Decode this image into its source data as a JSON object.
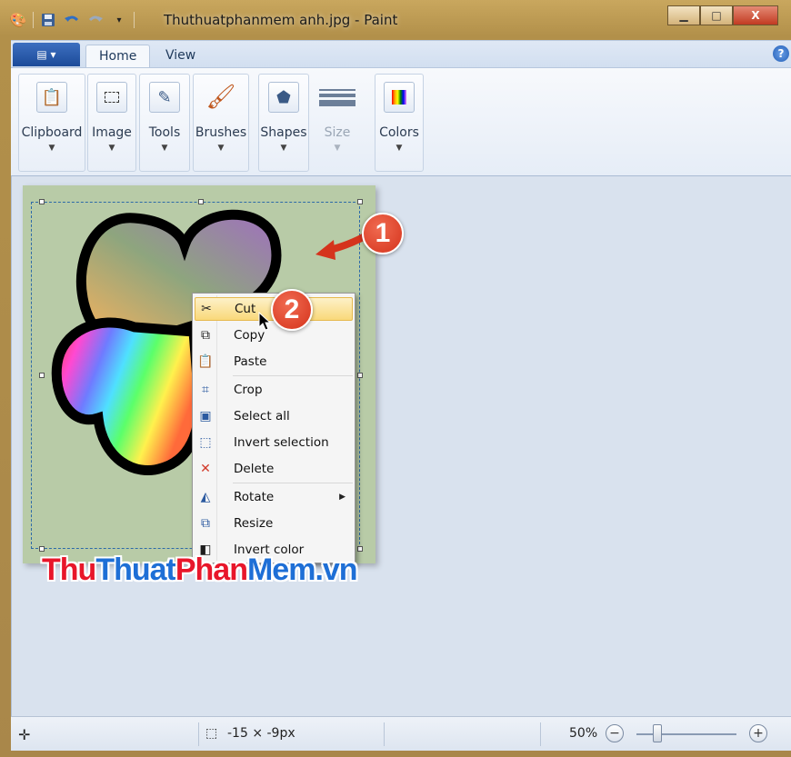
{
  "window": {
    "title": "Thuthuatphanmem anh.jpg - Paint",
    "minimize_icon": "minimize-icon",
    "maximize_icon": "maximize-icon",
    "close_label": "X"
  },
  "ribbon": {
    "tabs": [
      {
        "label": "Home",
        "active": true
      },
      {
        "label": "View",
        "active": false
      }
    ],
    "groups": [
      {
        "label": "Clipboard",
        "icon": "clipboard-icon"
      },
      {
        "label": "Image",
        "icon": "select-icon"
      },
      {
        "label": "Tools",
        "icon": "tools-icon"
      },
      {
        "label": "Brushes",
        "icon": "brush-icon"
      },
      {
        "label": "Shapes",
        "icon": "shapes-icon"
      },
      {
        "label": "Size",
        "icon": "size-icon",
        "disabled": true
      },
      {
        "label": "Colors",
        "icon": "colors-icon"
      }
    ],
    "help_label": "?"
  },
  "context_menu": {
    "items": [
      {
        "label": "Cut",
        "icon": "scissors-icon",
        "highlighted": true
      },
      {
        "label": "Copy",
        "icon": "copy-icon"
      },
      {
        "label": "Paste",
        "icon": "paste-icon"
      },
      {
        "label": "Crop",
        "icon": "crop-icon"
      },
      {
        "label": "Select all",
        "icon": "select-all-icon"
      },
      {
        "label": "Invert selection",
        "icon": "invert-selection-icon"
      },
      {
        "label": "Delete",
        "icon": "delete-icon"
      },
      {
        "label": "Rotate",
        "icon": "rotate-icon",
        "submenu": true
      },
      {
        "label": "Resize",
        "icon": "resize-icon"
      },
      {
        "label": "Invert color",
        "icon": "invert-color-icon"
      }
    ]
  },
  "annotations": {
    "step1": "1",
    "step2": "2"
  },
  "watermark": {
    "part1": "Thu",
    "part2": "Thuat",
    "part3": "Phan",
    "part4": "Mem.vn"
  },
  "statusbar": {
    "selection_size": "-15 × -9px",
    "zoom": "50%",
    "zoom_level_percent": 50,
    "zoom_out_label": "−",
    "zoom_in_label": "+"
  },
  "colors": {
    "accent_annotation": "#d5331c",
    "canvas_bg": "#b8cba7",
    "menu_highlight": "#f9d97a"
  }
}
